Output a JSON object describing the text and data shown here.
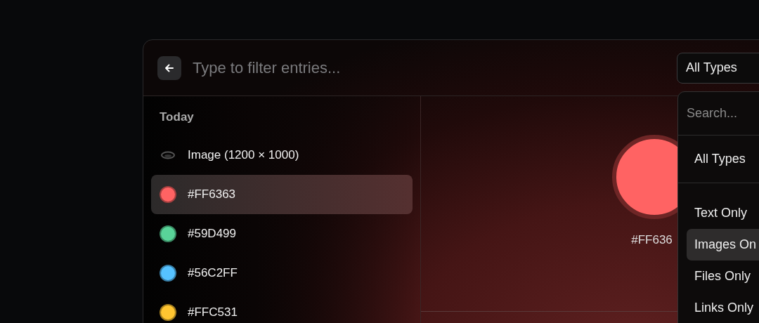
{
  "search": {
    "placeholder": "Type to filter entries..."
  },
  "type_filter": {
    "value": "All Types"
  },
  "list": {
    "heading": "Today",
    "items": [
      {
        "kind": "image",
        "label": "Image (1200 × 1000)",
        "selected": false
      },
      {
        "kind": "color",
        "label": "#FF6363",
        "color": "#ff6363",
        "selected": true
      },
      {
        "kind": "color",
        "label": "#59D499",
        "color": "#59d499",
        "selected": false
      },
      {
        "kind": "color",
        "label": "#56C2FF",
        "color": "#56c2ff",
        "selected": false
      },
      {
        "kind": "color",
        "label": "#FFC531",
        "color": "#ffc531",
        "selected": false
      }
    ]
  },
  "preview": {
    "color": "#ff6363",
    "label": "#FF636"
  },
  "dropdown": {
    "search_placeholder": "Search...",
    "groups": [
      [
        {
          "label": "All Types",
          "selected": false
        }
      ],
      [
        {
          "label": "Text Only",
          "selected": false
        },
        {
          "label": "Images On",
          "selected": true
        },
        {
          "label": "Files Only",
          "selected": false
        },
        {
          "label": "Links Only",
          "selected": false
        }
      ]
    ]
  }
}
